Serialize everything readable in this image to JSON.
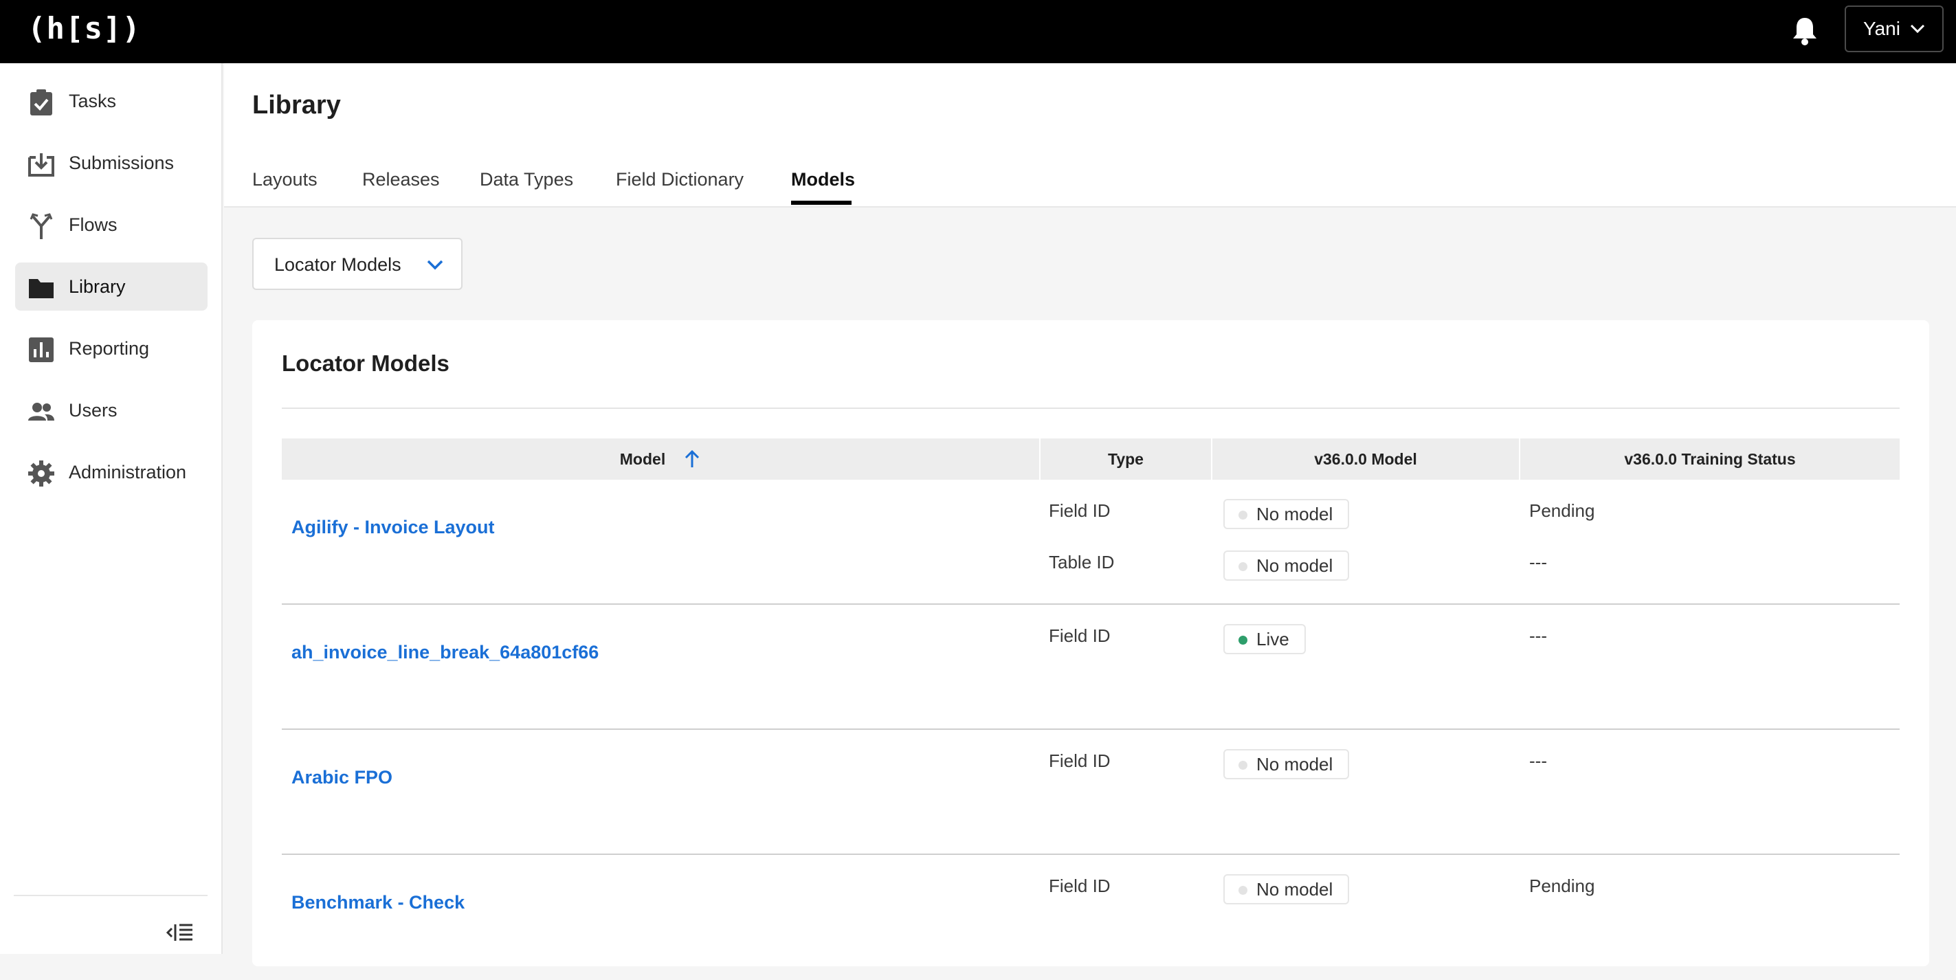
{
  "topbar": {
    "logo": "(h[s])",
    "user_name": "Yani"
  },
  "sidebar": {
    "items": [
      {
        "label": "Tasks",
        "icon": "clipboard-check-icon"
      },
      {
        "label": "Submissions",
        "icon": "inbox-download-icon"
      },
      {
        "label": "Flows",
        "icon": "flow-branch-icon"
      },
      {
        "label": "Library",
        "icon": "folder-icon",
        "active": true
      },
      {
        "label": "Reporting",
        "icon": "bar-chart-icon"
      },
      {
        "label": "Users",
        "icon": "users-icon"
      },
      {
        "label": "Administration",
        "icon": "gear-icon"
      }
    ]
  },
  "page": {
    "title": "Library",
    "tabs": [
      "Layouts",
      "Releases",
      "Data Types",
      "Field Dictionary",
      "Models"
    ],
    "active_tab": "Models"
  },
  "filter": {
    "selected": "Locator Models"
  },
  "card": {
    "title": "Locator Models",
    "columns": [
      "Model",
      "Type",
      "v36.0.0 Model",
      "v36.0.0 Training Status"
    ],
    "rows": [
      {
        "model": "Agilify - Invoice Layout",
        "entries": [
          {
            "type": "Field ID",
            "model_status": "No model",
            "training": "Pending"
          },
          {
            "type": "Table ID",
            "model_status": "No model",
            "training": "---"
          }
        ]
      },
      {
        "model": "ah_invoice_line_break_64a801cf66",
        "entries": [
          {
            "type": "Field ID",
            "model_status": "Live",
            "training": "---"
          }
        ]
      },
      {
        "model": "Arabic FPO",
        "entries": [
          {
            "type": "Field ID",
            "model_status": "No model",
            "training": "---"
          }
        ]
      },
      {
        "model": "Benchmark - Check",
        "entries": [
          {
            "type": "Field ID",
            "model_status": "No model",
            "training": "Pending"
          }
        ]
      }
    ]
  },
  "colors": {
    "link": "#1a6fd6",
    "live_dot": "#2e9e6b",
    "no_model_dot": "#e3e3e3",
    "active_nav": "#ebebeb"
  }
}
